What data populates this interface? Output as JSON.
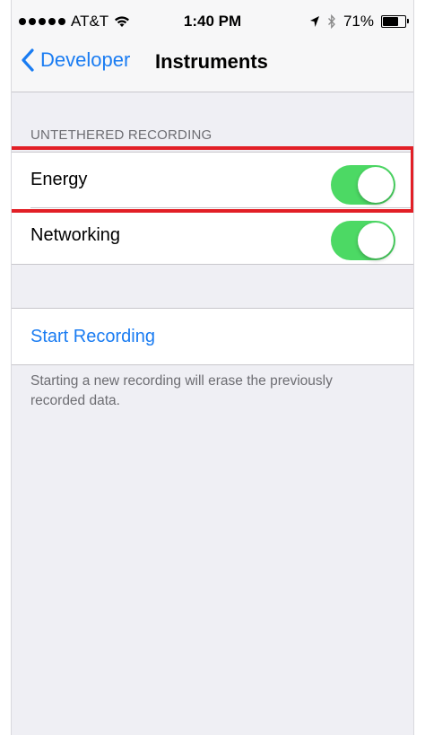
{
  "status_bar": {
    "carrier": "AT&T",
    "time": "1:40 PM",
    "battery": "71%",
    "battery_level": 0.71,
    "signal_bars": 5
  },
  "nav": {
    "back_label": "Developer",
    "title": "Instruments"
  },
  "untethered": {
    "header": "UNTETHERED RECORDING",
    "rows": [
      {
        "label": "Energy",
        "enabled": true
      },
      {
        "label": "Networking",
        "enabled": true
      }
    ]
  },
  "recording": {
    "action_label": "Start Recording",
    "footer": "Starting a new recording will erase the previously recorded data."
  },
  "colors": {
    "accent": "#1a7cf2",
    "toggle_on": "#4cd964",
    "highlight": "#e21f26",
    "background": "#efeff4"
  },
  "icons": [
    "signal-dots-icon",
    "wifi-icon",
    "location-arrow-icon",
    "bluetooth-icon",
    "battery-icon",
    "chevron-left-icon"
  ]
}
